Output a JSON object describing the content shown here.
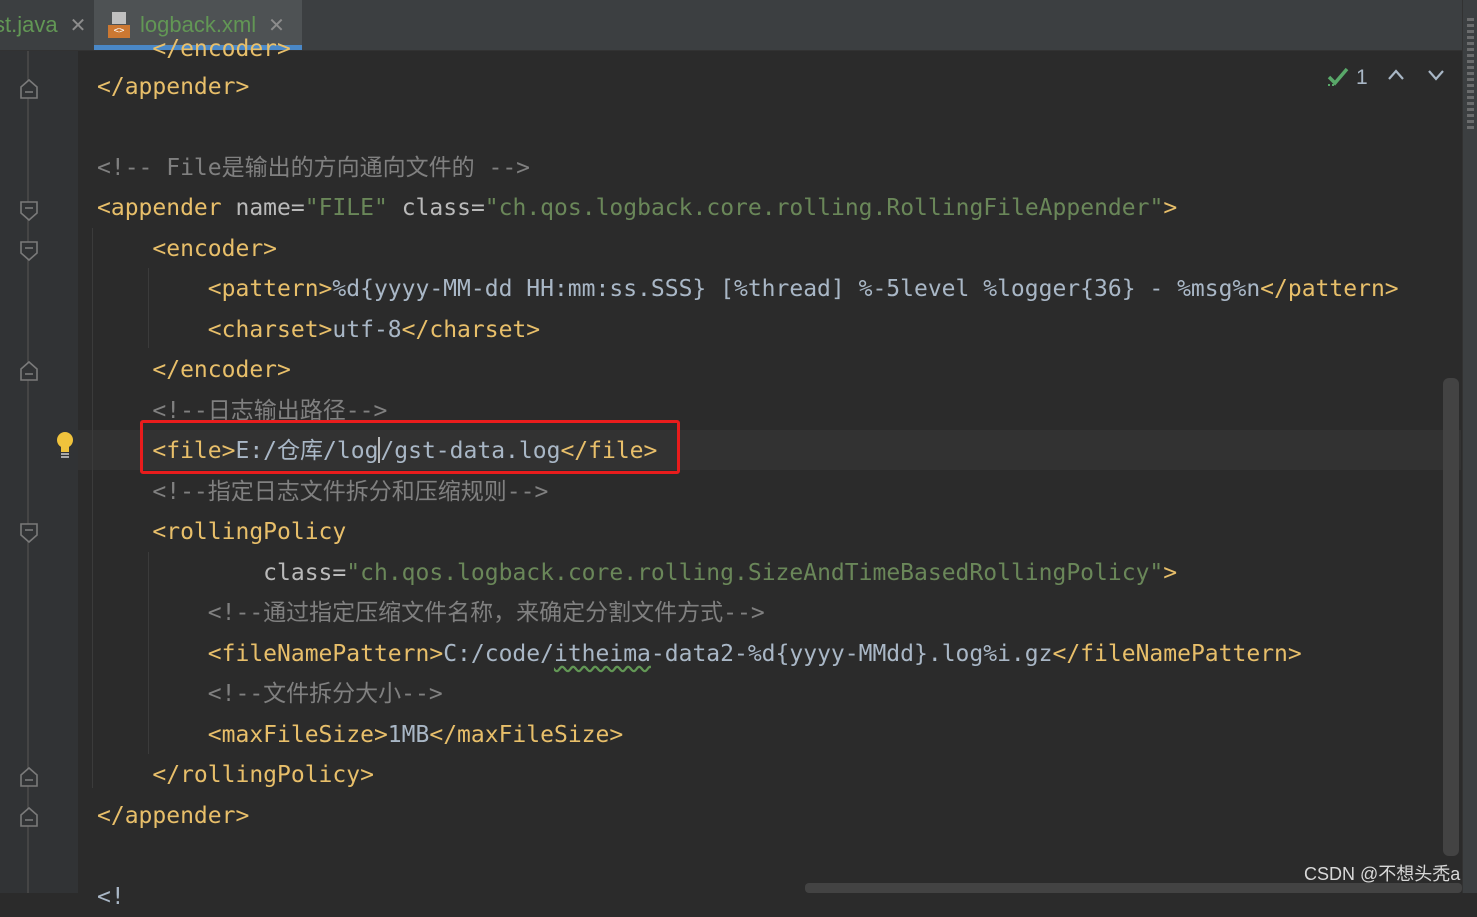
{
  "tabs": [
    {
      "label": "st.java",
      "active": false
    },
    {
      "label": "logback.xml",
      "active": true
    }
  ],
  "tab_close_glyph": "✕",
  "file_type_badge": "<>",
  "inspection": {
    "count": "1",
    "status_icon": "check-icon-green"
  },
  "code_lines": [
    "    </encoder>",
    "</appender>",
    "",
    "<!-- File是输出的方向通向文件的 -->",
    "<appender name=\"FILE\" class=\"ch.qos.logback.core.rolling.RollingFileAppender\">",
    "    <encoder>",
    "        <pattern>%d{yyyy-MM-dd HH:mm:ss.SSS} [%thread] %-5level %logger{36} - %msg%n</pattern>",
    "        <charset>utf-8</charset>",
    "    </encoder>",
    "    <!--日志输出路径-->",
    "    <file>E:/仓库/log/gst-data.log</file>",
    "    <!--指定日志文件拆分和压缩规则-->",
    "    <rollingPolicy",
    "            class=\"ch.qos.logback.core.rolling.SizeAndTimeBasedRollingPolicy\">",
    "        <!--通过指定压缩文件名称，来确定分割文件方式-->",
    "        <fileNamePattern>C:/code/itheima-data2-%d{yyyy-MMdd}.log%i.gz</fileNamePattern>",
    "        <!--文件拆分大小-->",
    "        <maxFileSize>1MB</maxFileSize>",
    "    </rollingPolicy>",
    "</appender>",
    "",
    "<!"
  ],
  "highlighted_line": "<file>E:/仓库/log/gst-data.log</file>",
  "watermark": "CSDN @不想头秃a",
  "colors": {
    "editor_bg": "#2b2b2b",
    "tag": "#e8bf6a",
    "attribute": "#bababa",
    "string": "#6a8759",
    "text": "#a9b7c6",
    "comment": "#808080",
    "highlight_box": "#e81c1c",
    "active_tab_underline": "#4a88c7"
  }
}
